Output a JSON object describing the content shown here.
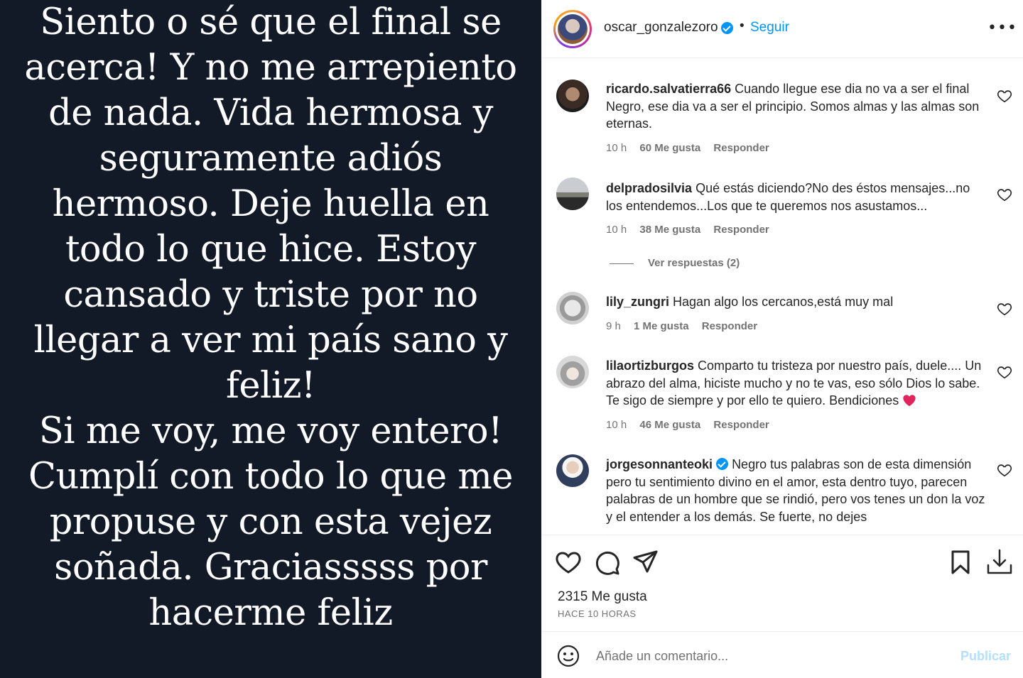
{
  "post_image": {
    "lines": [
      "Siento o sé que el final se",
      "acerca! Y no me arrepiento",
      "de nada. Vida hermosa y",
      "seguramente adiós",
      "hermoso. Deje huella en",
      "todo lo que hice. Estoy",
      "cansado y triste por no",
      "llegar a ver mi país sano y",
      "feliz!",
      "Si me voy, me voy entero!",
      "Cumplí con todo lo que me",
      "propuse y con esta vejez",
      "soñada. Graciasssss por",
      "hacerme feliz"
    ]
  },
  "header": {
    "username": "oscar_gonzalezoro",
    "separator": "•",
    "follow_label": "Seguir",
    "more_label": "•••",
    "verified_icon": "verified-badge-icon"
  },
  "comments": [
    {
      "username": "ricardo.salvatierra66",
      "text": "Cuando llegue ese dia no va a ser el final Negro, ese dia va a ser el principio. Somos almas y las almas son eternas.",
      "time": "10 h",
      "likes": "60 Me gusta",
      "reply": "Responder"
    },
    {
      "username": "delpradosilvia",
      "text": "Qué estás diciendo?No des éstos mensajes...no los entendemos...Los que te queremos nos asustamos...",
      "time": "10 h",
      "likes": "38 Me gusta",
      "reply": "Responder",
      "view_replies": "Ver respuestas (2)"
    },
    {
      "username": "lily_zungri",
      "text": "Hagan algo los cercanos,está muy mal",
      "time": "9 h",
      "likes": "1 Me gusta",
      "reply": "Responder"
    },
    {
      "username": "lilaortizburgos",
      "text": "Comparto tu tristeza por nuestro país, duele.... Un abrazo del alma, hiciste mucho y no te vas, eso sólo Dios lo sabe. Te sigo de siempre y por ello te quiero. Bendiciones",
      "emoji": "red-heart",
      "time": "10 h",
      "likes": "46 Me gusta",
      "reply": "Responder"
    },
    {
      "username": "jorgesonnanteoki",
      "verified": true,
      "text": "Negro tus palabras son de esta dimensión pero tu sentimiento divino en el amor, esta dentro tuyo, parecen palabras de un hombre que se rindió, pero vos tenes un don la voz y el entender a los demás. Se fuerte, no dejes"
    }
  ],
  "actions": {
    "likes_count": "2315 Me gusta",
    "post_time": "HACE 10 HORAS",
    "icons": [
      "heart-icon",
      "comment-icon",
      "share-icon",
      "bookmark-icon",
      "download-icon"
    ]
  },
  "add_comment": {
    "placeholder": "Añade un comentario...",
    "publish_label": "Publicar"
  },
  "colors": {
    "image_bg": "#121a27",
    "link_blue": "#0095f6",
    "publish_disabled": "#b2dffc",
    "meta_gray": "#737373",
    "heart_red": "#e0245e"
  }
}
